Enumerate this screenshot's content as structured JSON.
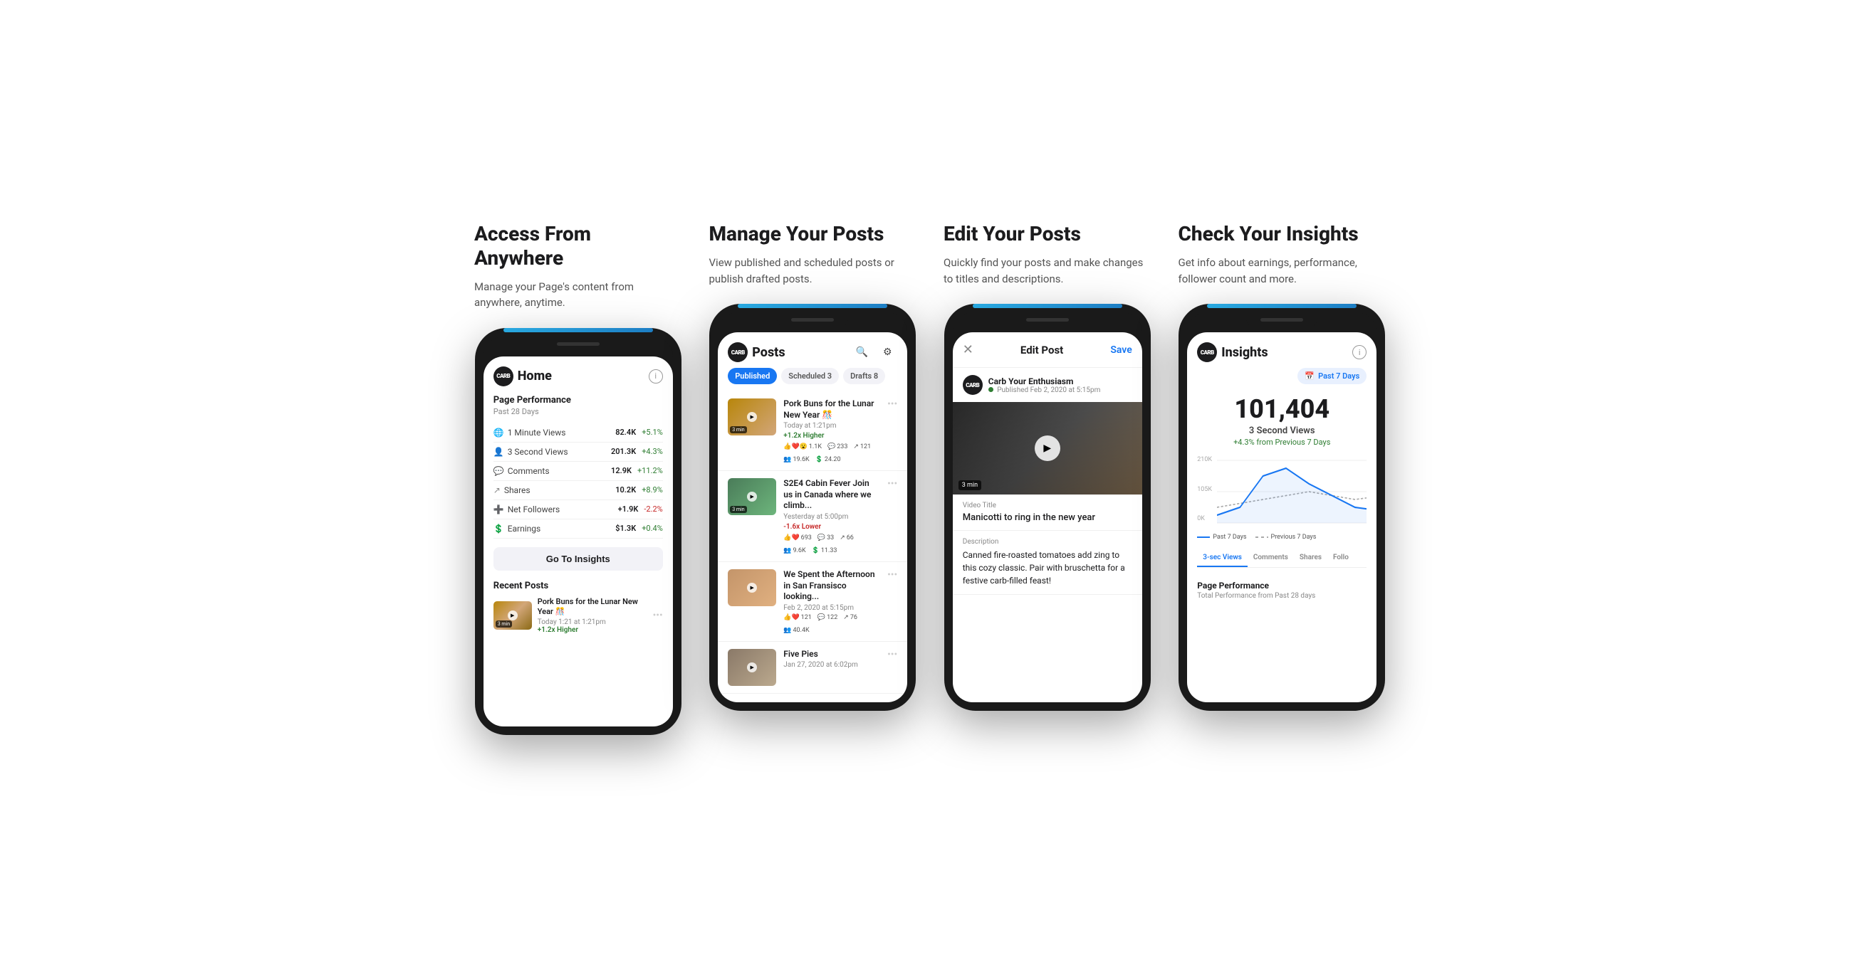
{
  "cards": [
    {
      "id": "access",
      "title": "Access From Anywhere",
      "description": "Manage your Page's content from anywhere, anytime.",
      "screen": "home"
    },
    {
      "id": "manage",
      "title": "Manage Your Posts",
      "description": "View published and scheduled posts or publish drafted posts.",
      "screen": "posts"
    },
    {
      "id": "edit",
      "title": "Edit Your Posts",
      "description": "Quickly find your posts and make changes to titles and descriptions.",
      "screen": "edit"
    },
    {
      "id": "insights",
      "title": "Check Your Insights",
      "description": "Get info about earnings, performance, follower count and more.",
      "screen": "insights"
    }
  ],
  "home": {
    "logo_text": "CARB",
    "title": "Home",
    "section_label": "Page Performance",
    "section_sublabel": "Past 28 Days",
    "stats": [
      {
        "label": "1 Minute Views",
        "icon": "🌐",
        "value": "82.4K",
        "change": "+5.1%",
        "positive": true
      },
      {
        "label": "3 Second Views",
        "icon": "👤",
        "value": "201.3K",
        "change": "+4.3%",
        "positive": true
      },
      {
        "label": "Comments",
        "icon": "💬",
        "value": "12.9K",
        "change": "+11.2%",
        "positive": true
      },
      {
        "label": "Shares",
        "icon": "↗",
        "value": "10.2K",
        "change": "+8.9%",
        "positive": true
      },
      {
        "label": "Net Followers",
        "icon": "➕",
        "value": "+1.9K",
        "change": "-2.2%",
        "positive": false
      },
      {
        "label": "Earnings",
        "icon": "💲",
        "value": "$1.3K",
        "change": "+0.4%",
        "positive": true
      }
    ],
    "insights_btn": "Go To Insights",
    "recent_posts_label": "Recent Posts",
    "recent_post": {
      "title": "Pork Buns for the Lunar New Year 🎊",
      "date": "Today 1:21 at 1:21pm",
      "perf": "+1.2x Higher",
      "duration": "3 min"
    }
  },
  "posts": {
    "logo_text": "CARB",
    "title": "Posts",
    "tabs": [
      {
        "label": "Published",
        "active": true
      },
      {
        "label": "Scheduled 3",
        "active": false
      },
      {
        "label": "Drafts 8",
        "active": false
      }
    ],
    "items": [
      {
        "title": "Pork Buns for the Lunar New Year 🎊",
        "date": "Today at 1:21pm",
        "perf": "+1.2x Higher",
        "perf_positive": true,
        "likes": "1.1K",
        "comments": "233",
        "shares": "121",
        "views": "19.6K",
        "earnings": "24.20",
        "duration": "3 min"
      },
      {
        "title": "S2E4 Cabin Fever Join us in Canada where we climb...",
        "date": "Yesterday at 5:00pm",
        "perf": "-1.6x Lower",
        "perf_positive": false,
        "likes": "693",
        "comments": "33",
        "shares": "66",
        "views": "9.6K",
        "earnings": "11.33",
        "duration": "3 min"
      },
      {
        "title": "We Spent the Afternoon in San Fransisco looking...",
        "date": "Feb 2, 2020 at 5:15pm",
        "perf": "",
        "perf_positive": true,
        "likes": "121",
        "comments": "122",
        "shares": "76",
        "views": "40.4K",
        "earnings": "",
        "duration": ""
      },
      {
        "title": "Five Pies",
        "date": "Jan 27, 2020 at 6:02pm",
        "perf": "",
        "perf_positive": true,
        "likes": "",
        "comments": "",
        "shares": "",
        "views": "",
        "earnings": "",
        "duration": ""
      }
    ]
  },
  "edit": {
    "header_title": "Edit Post",
    "save_label": "Save",
    "author_name": "Carb Your Enthusiasm",
    "author_meta": "Published Feb 2, 2020 at 5:15pm",
    "video_duration": "3 min",
    "video_title_label": "Video Title",
    "video_title_value": "Manicotti to ring in the new year",
    "description_label": "Description",
    "description_value": "Canned fire-roasted tomatoes add zing to this cozy classic. Pair with bruschetta for a festive carb-filled feast!"
  },
  "insights": {
    "logo_text": "CARB",
    "title": "Insights",
    "period": "Past 7 Days",
    "big_number": "101,404",
    "big_label": "3 Second Views",
    "big_change": "+4.3% from Previous 7 Days",
    "y_labels": [
      "210K",
      "105K",
      "0K"
    ],
    "tabs": [
      {
        "label": "3-sec Views",
        "active": true
      },
      {
        "label": "Comments",
        "active": false
      },
      {
        "label": "Shares",
        "active": false
      },
      {
        "label": "Follo",
        "active": false
      }
    ],
    "legend": [
      {
        "label": "Past 7 Days",
        "type": "solid"
      },
      {
        "label": "Previous 7 Days",
        "type": "dashed"
      }
    ],
    "page_perf_title": "Page Performance",
    "page_perf_sub": "Total Performance from Past 28 days"
  }
}
